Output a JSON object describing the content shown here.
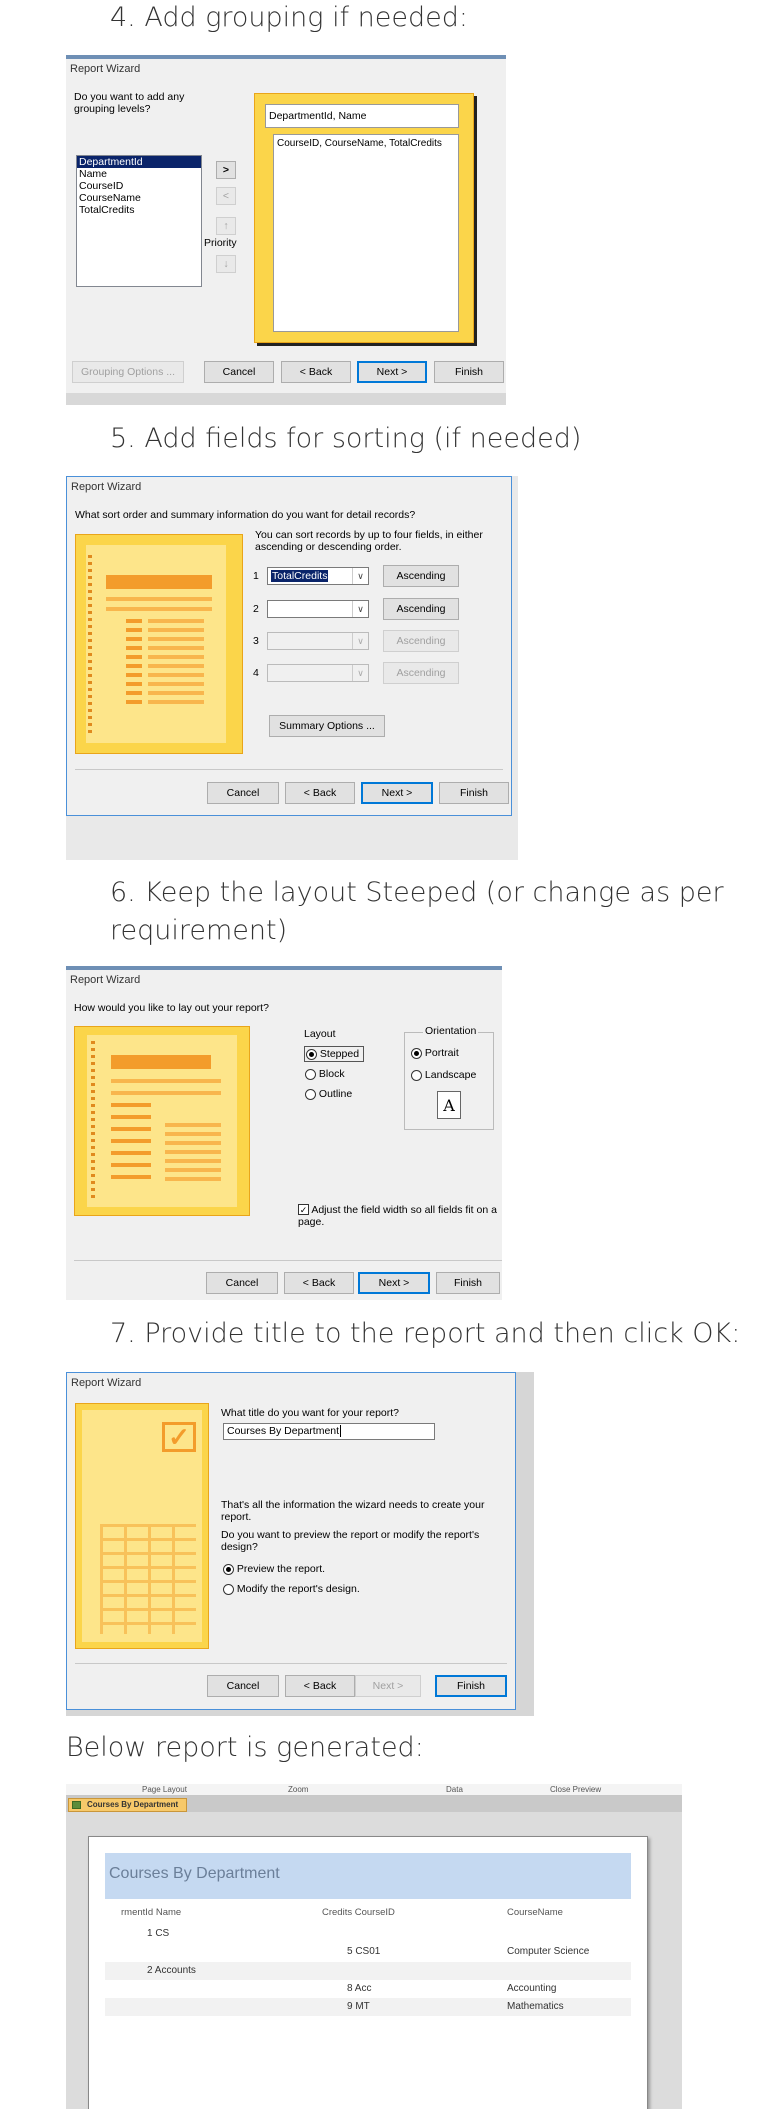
{
  "headings": {
    "step4": "4. Add grouping if needed:",
    "step5": "5. Add fields for sorting (if needed)",
    "step6_line1": "6. Keep the layout Steeped (or change as per",
    "step6_line2": "requirement)",
    "step7": "7. Provide title to the report and then click OK:",
    "result": "Below report is generated:"
  },
  "wizard_title": "Report Wizard",
  "buttons": {
    "grouping_options": "Grouping Options ...",
    "cancel": "Cancel",
    "back": "< Back",
    "next": "Next >",
    "finish": "Finish",
    "summary_options": "Summary Options ...",
    "ascending": "Ascending",
    "add": ">",
    "remove": "<",
    "priority_up": "↑",
    "priority_down": "↓"
  },
  "step4": {
    "question": "Do you want to add any grouping levels?",
    "fields": [
      "DepartmentId",
      "Name",
      "CourseID",
      "CourseName",
      "TotalCredits"
    ],
    "selected_field": "DepartmentId",
    "priority_label": "Priority",
    "group_header": "DepartmentId, Name",
    "group_detail": "CourseID, CourseName, TotalCredits"
  },
  "step5": {
    "question": "What sort order and summary information do you want for detail records?",
    "info": "You can sort records by up to four fields, in either ascending or descending order.",
    "rows": [
      {
        "num": "1",
        "value": "TotalCredits"
      },
      {
        "num": "2",
        "value": ""
      },
      {
        "num": "3",
        "value": ""
      },
      {
        "num": "4",
        "value": ""
      }
    ]
  },
  "step6": {
    "question": "How would you like to lay out your report?",
    "layout_label": "Layout",
    "layouts": [
      "Stepped",
      "Block",
      "Outline"
    ],
    "selected_layout": "Stepped",
    "orientation_label": "Orientation",
    "orientations": [
      "Portrait",
      "Landscape"
    ],
    "selected_orientation": "Portrait",
    "orientation_icon_letter": "A",
    "adjust_label": "Adjust the field width so all fields fit on a page.",
    "adjust_checked": true
  },
  "step7": {
    "question": "What title do you want for your report?",
    "title_value": "Courses By Department",
    "info1": "That's all the information the wizard needs to create your report.",
    "info2": "Do you want to preview the report or modify the report's design?",
    "options": [
      "Preview the report.",
      "Modify the report's design."
    ],
    "selected_option": "Preview the report."
  },
  "report": {
    "ribbon_groups": [
      "Page Layout",
      "Zoom",
      "Data",
      "Close Preview"
    ],
    "tab_name": "Courses By Department",
    "title": "Courses By Department",
    "columns": [
      "rmentId Name",
      "Credits CourseID",
      "CourseName"
    ],
    "rows": [
      {
        "a": "1 CS",
        "b": "",
        "c": ""
      },
      {
        "a": "",
        "b": "5 CS01",
        "c": "Computer Science"
      },
      {
        "a": "2 Accounts",
        "b": "",
        "c": ""
      },
      {
        "a": "",
        "b": "8 Acc",
        "c": "Accounting"
      },
      {
        "a": "",
        "b": "9 MT",
        "c": "Mathematics"
      }
    ]
  },
  "colors": {
    "accent_blue": "#0078d7",
    "wizard_art_yellow": "#fbd54a",
    "report_title_band": "#c5d9f1",
    "report_title_text": "#6b7f99",
    "selection_navy": "#0a246a"
  }
}
